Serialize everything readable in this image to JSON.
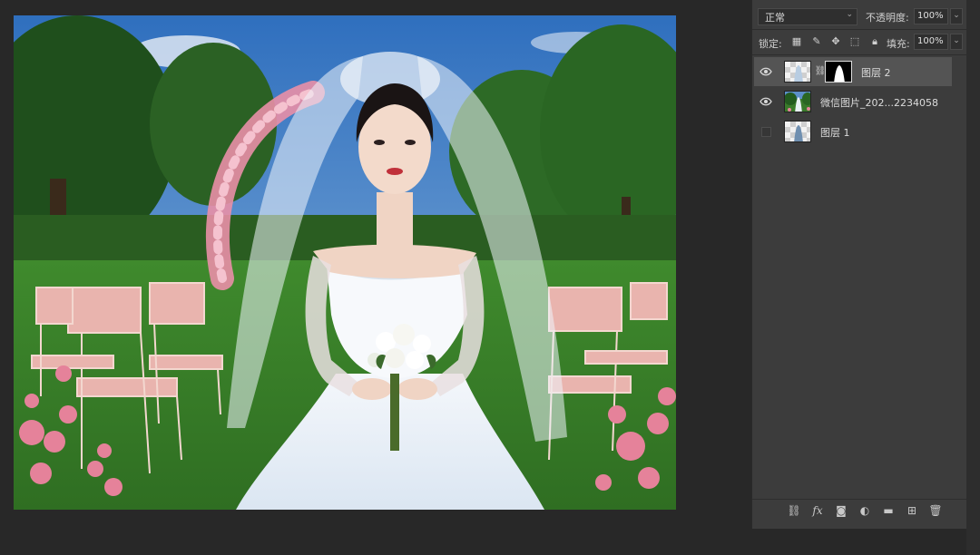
{
  "layers_panel": {
    "blend_mode": "正常",
    "opacity_label": "不透明度:",
    "opacity_value": "100%",
    "lock_label": "锁定:",
    "fill_label": "填充:",
    "fill_value": "100%",
    "layers": [
      {
        "name": "图层 2",
        "visible": true,
        "selected": true,
        "has_mask": true
      },
      {
        "name": "微信图片_202...2234058",
        "visible": true,
        "selected": false,
        "has_mask": false
      },
      {
        "name": "图层 1",
        "visible": false,
        "selected": false,
        "has_mask": false
      }
    ],
    "bottom_icons": [
      "link-icon",
      "fx-icon",
      "add-mask-icon",
      "adjustment-icon",
      "group-folder-icon",
      "new-layer-icon",
      "delete-icon"
    ],
    "fx_label": "fx"
  },
  "canvas": {
    "subject": "bride in white wedding dress with veil holding white rose bouquet",
    "scene_colors": {
      "sky": "#3f7fc6",
      "grass": "#3d8a2e",
      "chairs": "#eab7b0",
      "roses": "#e57b97"
    }
  }
}
